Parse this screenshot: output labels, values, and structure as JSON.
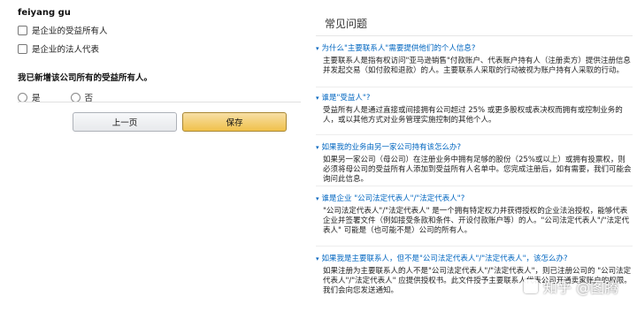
{
  "left": {
    "owner_name": "feiyang gu",
    "checkboxes": [
      {
        "label": "是企业的受益所有人"
      },
      {
        "label": "是企业的法人代表"
      }
    ],
    "question": "我已新增该公司所有的受益所有人。",
    "radios": [
      {
        "label": "是"
      },
      {
        "label": "否"
      }
    ],
    "prev_button": "上一页",
    "save_button": "保存"
  },
  "faq": {
    "title": "常见问题",
    "items": [
      {
        "question": "为什么\"主要联系人\"需要提供他们的个人信息?",
        "answer": "主要联系人是指有权访问\"亚马逊销售\"付款账户、代表账户持有人（注册卖方）提供注册信息并发起交易（如付款和退款）的人。主要联系人采取的行动被视为账户持有人采取的行动。"
      },
      {
        "question": "谁是\"受益人\"?",
        "answer": "受益所有人是通过直接或间接拥有公司超过 25% 或更多股权或表决权而拥有或控制业务的人，或以其他方式对业务管理实施控制的其他个人。"
      },
      {
        "question": "如果我的业务由另一家公司持有该怎么办?",
        "answer": "如果另一家公司（母公司）在注册业务中拥有足够的股份（25%或以上）或拥有投票权，则必须将母公司的受益所有人添加到受益所有人名单中。您完成注册后，如有需要，我们可能会询问此信息。"
      },
      {
        "question": "谁是企业 \"公司法定代表人\"/\"法定代表人\"?",
        "answer": "\"公司法定代表人\"/\"法定代表人\" 是一个拥有特定权力并获得授权的企业法治授权，能够代表企业并签署文件（例如接受条款和条件、开设付款账户等）的人。\"公司法定代表人\"/\"法定代表人\" 可能是（也可能不是）公司的所有人。"
      },
      {
        "question": "如果我是主要联系人，但不是\"公司法定代表人\"/\"法定代表人\"，该怎么办?",
        "answer": "如果注册为主要联系人的人不是\"公司法定代表人\"/\"法定代表人\"，则已注册公司的 \"公司法定代表人\"/\"法定代表人\" 应提供授权书。此文件授予主要联系人代表公司开通卖家账户的权限。我们会向您发送通知。"
      }
    ]
  },
  "watermark": "知乎 @图腾"
}
